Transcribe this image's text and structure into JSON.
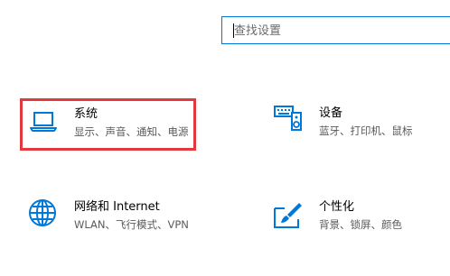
{
  "search": {
    "placeholder": "查找设置"
  },
  "tiles": [
    {
      "title": "系统",
      "subtitle": "显示、声音、通知、电源",
      "icon": "laptop-icon"
    },
    {
      "title": "设备",
      "subtitle": "蓝牙、打印机、鼠标",
      "icon": "keyboard-speaker-icon"
    },
    {
      "title": "网络和 Internet",
      "subtitle": "WLAN、飞行模式、VPN",
      "icon": "globe-icon"
    },
    {
      "title": "个性化",
      "subtitle": "背景、锁屏、颜色",
      "icon": "paint-tablet-icon"
    }
  ],
  "colors": {
    "accent": "#0078d7",
    "highlight_border": "#e0393e"
  }
}
